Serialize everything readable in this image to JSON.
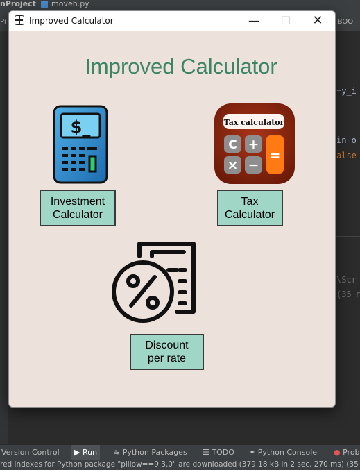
{
  "ide": {
    "project_label": "nProject",
    "file_tab": "moveh.py",
    "left_tab": "Pı",
    "right_tab": "L BOO",
    "code_lines": [
      "=y_i",
      "in o",
      "alse"
    ],
    "lower_code": "\\Scr",
    "lower_code2": "(35 mi",
    "bottom_bar": {
      "version_control": "Version Control",
      "run": "Run",
      "python_packages": "Python Packages",
      "todo": "TODO",
      "python_console": "Python Console",
      "problems": "Prob"
    },
    "status_text": "red indexes for Python package \"pillow==9.3.0\" are downloaded (379.18 kB in 2 sec, 270 ms) (35 mi"
  },
  "window": {
    "title": "Improved Calculator",
    "controls": {
      "minimize": "—",
      "maximize": "☐",
      "close": "✕"
    }
  },
  "app": {
    "heading": "Improved Calculator",
    "investment_button": "Investment\nCalculator",
    "tax_button": "Tax\nCalculator",
    "discount_button": "Discount\nper rate",
    "tax_icon_text": "Tax calculator",
    "investment_icon_text": "$_",
    "tax_keys": [
      "C",
      "+",
      "×",
      "−",
      "="
    ]
  },
  "colors": {
    "heading": "#3e8565",
    "button_bg": "#9fd6c5",
    "window_bg": "#ede1dc",
    "tax_icon_bg": "#8c2610",
    "tax_equals": "#ff7a12"
  }
}
